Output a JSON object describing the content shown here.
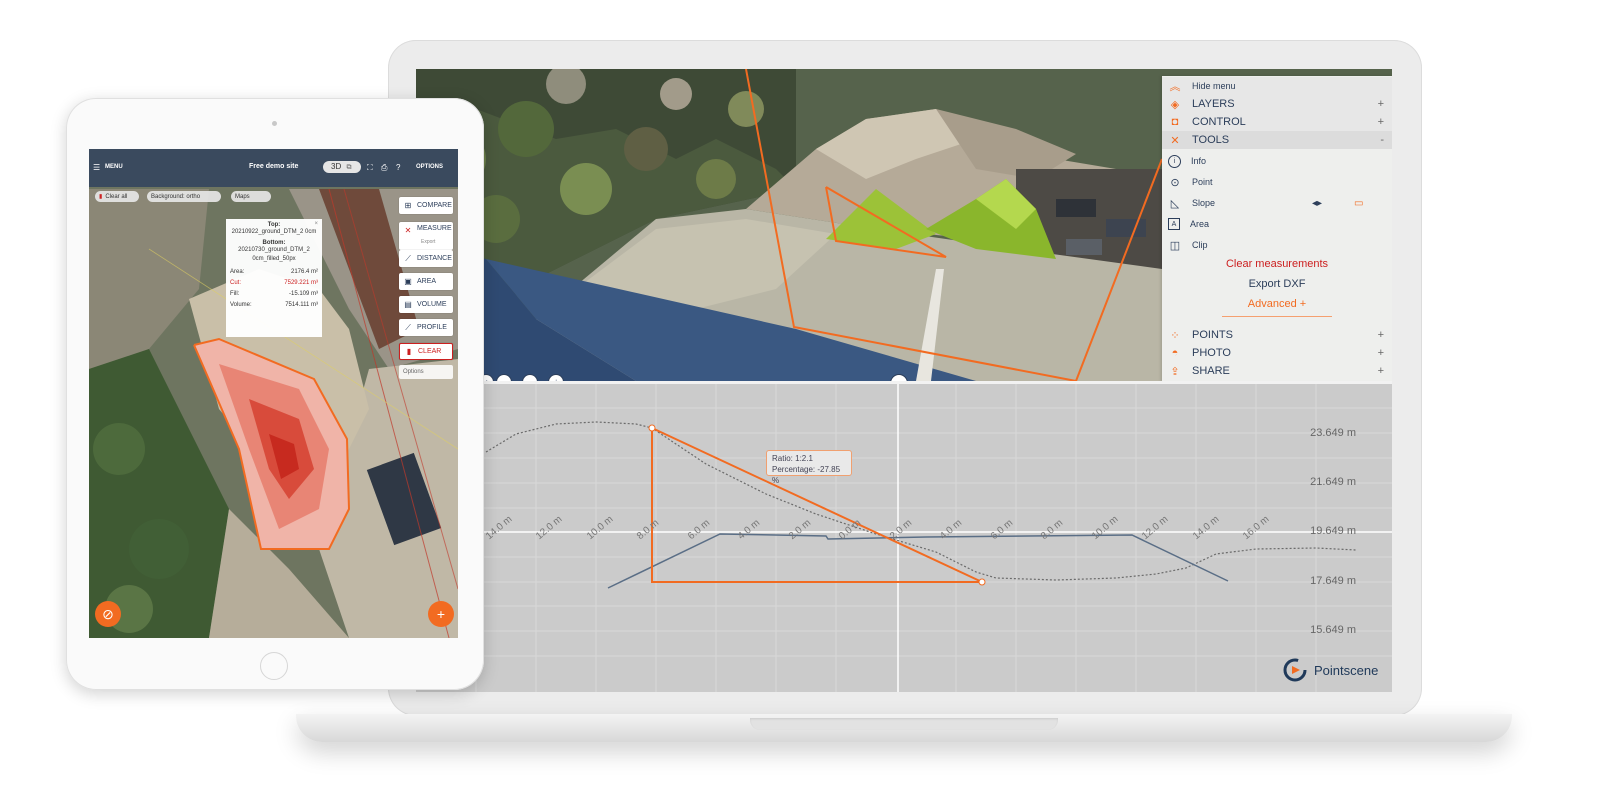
{
  "laptop": {
    "menu": {
      "hide_menu": "Hide menu",
      "layers": "LAYERS",
      "control": "CONTROL",
      "tools": "TOOLS",
      "tools_items": [
        "Info",
        "Point",
        "Slope",
        "Area",
        "Clip"
      ],
      "clear_measurements": "Clear measurements",
      "export_dxf": "Export DXF",
      "advanced": "Advanced +",
      "points": "POINTS",
      "photo": "PHOTO",
      "share": "SHARE",
      "plus": "+",
      "minus": "-"
    },
    "profile": {
      "y_labels": [
        "23.649 m",
        "21.649 m",
        "19.649 m",
        "17.649 m",
        "15.649 m"
      ],
      "x_labels": [
        "16.0 m",
        "14.0 m",
        "12.0 m",
        "10.0 m",
        "8.0 m",
        "6.0 m",
        "4.0 m",
        "2.0 m",
        "0.0 m",
        "2.0 m",
        "4.0 m",
        "6.0 m",
        "8.0 m",
        "10.0 m",
        "12.0 m",
        "14.0 m",
        "16.0 m"
      ],
      "tooltip_ratio": "Ratio: 1:2.1",
      "tooltip_percentage": "Percentage: -27.85 %"
    },
    "brand": "Pointscene",
    "colors": {
      "accent": "#f26b21",
      "navy": "#2c3e5a",
      "danger": "#cc1f1f"
    }
  },
  "tablet": {
    "menu": "MENU",
    "site_title": "Free demo site",
    "view_mode": "3D",
    "options": "OPTIONS",
    "chips": [
      "Clear all",
      "Background: ortho",
      "Maps"
    ],
    "tools": {
      "compare": "COMPARE",
      "measure": "MEASURE",
      "export": "Export",
      "distance": "DISTANCE",
      "area": "AREA",
      "volume": "VOLUME",
      "profile": "PROFILE",
      "clear": "CLEAR",
      "options": "Options"
    },
    "popup": {
      "top_label": "Top:",
      "top_value": "20210922_ground_DTM_2 0cm",
      "bottom_label": "Bottom:",
      "bottom_value": "20210730_ground_DTM_2 0cm_filled_50px",
      "area_label": "Area:",
      "area_value": "2176.4 m²",
      "cut_label": "Cut:",
      "cut_value": "7529.221 m³",
      "fill_label": "Fill:",
      "fill_value": "-15.109 m³",
      "volume_label": "Volume:",
      "volume_value": "7514.111 m³"
    }
  }
}
